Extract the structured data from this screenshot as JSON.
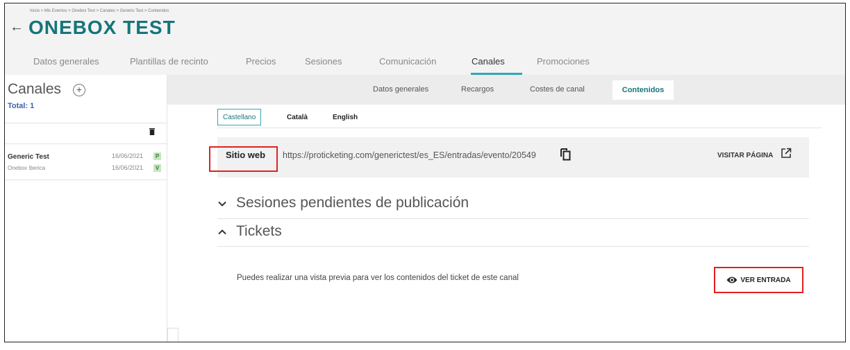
{
  "header": {
    "breadcrumb": "Inicio > Mis Eventos > Onebox Test > Canales > Generic Test > Contenidos",
    "title": "ONEBOX TEST",
    "tabs": [
      {
        "label": "Datos generales"
      },
      {
        "label": "Plantillas de recinto"
      },
      {
        "label": "Precios"
      },
      {
        "label": "Sesiones"
      },
      {
        "label": "Comunicación"
      },
      {
        "label": "Canales"
      },
      {
        "label": "Promociones"
      }
    ],
    "active_tab": "Canales"
  },
  "subnav": {
    "tabs": [
      {
        "label": "Datos generales"
      },
      {
        "label": "Recargos"
      },
      {
        "label": "Costes de canal"
      },
      {
        "label": "Contenidos"
      }
    ],
    "active_tab": "Contenidos"
  },
  "sidebar": {
    "title": "Canales",
    "add_label": "+",
    "total": "Total: 1",
    "items": [
      {
        "name": "Generic Test",
        "sub": "Onebox Iberica",
        "date1": "16/06/2021",
        "badge1": "P",
        "date2": "16/06/2021",
        "badge2": "V"
      }
    ]
  },
  "languages": {
    "tabs": [
      {
        "label": "Castellano"
      },
      {
        "label": "Català"
      },
      {
        "label": "English"
      }
    ],
    "active": "Castellano"
  },
  "website": {
    "label": "Sitio web",
    "url": "https://proticketing.com/generictest/es_ES/entradas/evento/20549",
    "visit_label": "VISITAR PÁGINA"
  },
  "sections": {
    "pending": {
      "title": "Sesiones pendientes de publicación",
      "expanded": false
    },
    "tickets": {
      "title": "Tickets",
      "expanded": true,
      "text": "Puedes realizar una vista previa para ver los contenidos del ticket de este canal",
      "button_label": "VER ENTRADA"
    }
  },
  "colors": {
    "title": "#15757a",
    "accent": "#2fa7b5",
    "total": "#3c5fa8",
    "highlight": "#e02020",
    "badge_bg": "#c7e5c2"
  }
}
